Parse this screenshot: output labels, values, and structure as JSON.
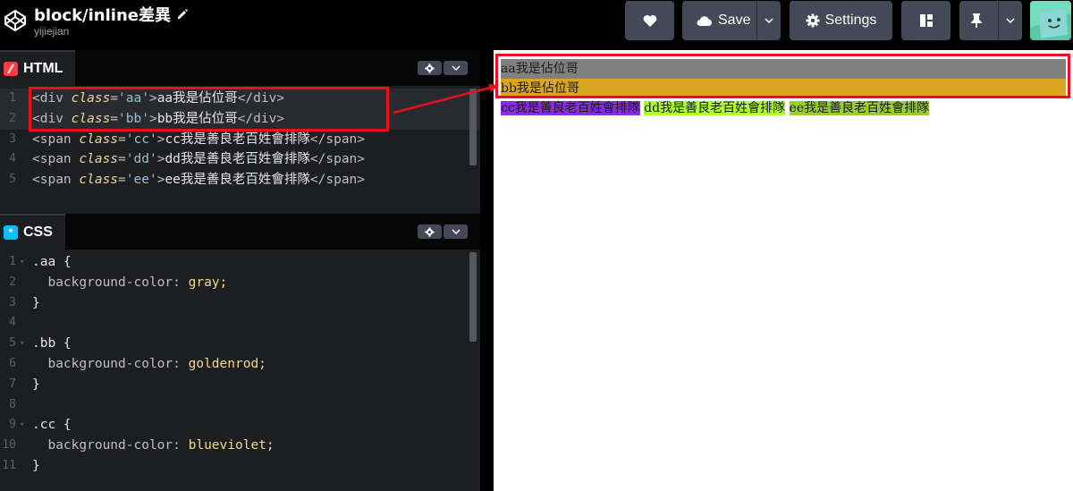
{
  "header": {
    "title": "block/inline差異",
    "author": "yijiejian",
    "save_label": "Save",
    "settings_label": "Settings"
  },
  "html_panel": {
    "tab_label": "HTML",
    "lines": [
      {
        "num": "1",
        "open": "<div ",
        "attr": "class",
        "eq": "=",
        "str": "'aa'",
        "gt": ">",
        "text": "aa我是佔位哥",
        "close": "</div>"
      },
      {
        "num": "2",
        "open": "<div ",
        "attr": "class",
        "eq": "=",
        "str": "'bb'",
        "gt": ">",
        "text": "bb我是佔位哥",
        "close": "</div>"
      },
      {
        "num": "3",
        "open": "<span ",
        "attr": "class",
        "eq": "=",
        "str": "'cc'",
        "gt": ">",
        "text": "cc我是善良老百姓會排隊",
        "close": "</span>"
      },
      {
        "num": "4",
        "open": "<span ",
        "attr": "class",
        "eq": "=",
        "str": "'dd'",
        "gt": ">",
        "text": "dd我是善良老百姓會排隊",
        "close": "</span>"
      },
      {
        "num": "5",
        "open": "<span ",
        "attr": "class",
        "eq": "=",
        "str": "'ee'",
        "gt": ">",
        "text": "ee我是善良老百姓會排隊",
        "close": "</span>"
      }
    ]
  },
  "css_panel": {
    "tab_label": "CSS",
    "lines": [
      {
        "num": "1",
        "sel": ".aa {",
        "prop": "",
        "val": ""
      },
      {
        "num": "2",
        "sel": "",
        "prop": "  background-color: ",
        "val": "gray;"
      },
      {
        "num": "3",
        "sel": "}",
        "prop": "",
        "val": ""
      },
      {
        "num": "4",
        "sel": "",
        "prop": "",
        "val": ""
      },
      {
        "num": "5",
        "sel": ".bb {",
        "prop": "",
        "val": ""
      },
      {
        "num": "6",
        "sel": "",
        "prop": "  background-color: ",
        "val": "goldenrod;"
      },
      {
        "num": "7",
        "sel": "}",
        "prop": "",
        "val": ""
      },
      {
        "num": "8",
        "sel": "",
        "prop": "",
        "val": ""
      },
      {
        "num": "9",
        "sel": ".cc {",
        "prop": "",
        "val": ""
      },
      {
        "num": "10",
        "sel": "",
        "prop": "  background-color: ",
        "val": "blueviolet;"
      },
      {
        "num": "11",
        "sel": "}",
        "prop": "",
        "val": ""
      }
    ]
  },
  "preview": {
    "aa": "aa我是佔位哥",
    "bb": "bb我是佔位哥",
    "cc": "cc我是善良老百姓會排隊",
    "dd": "dd我是善良老百姓會排隊",
    "ee": "ee我是善良老百姓會排隊"
  },
  "colors": {
    "annotation_red": "#e8101a",
    "html_badge": "#ff3c41",
    "css_badge": "#0ebeff"
  },
  "icons": [
    "codepen-logo-icon",
    "pencil-icon",
    "heart-icon",
    "cloud-icon",
    "chevron-down-icon",
    "gear-icon",
    "layout-icon",
    "pin-icon",
    "avatar"
  ]
}
